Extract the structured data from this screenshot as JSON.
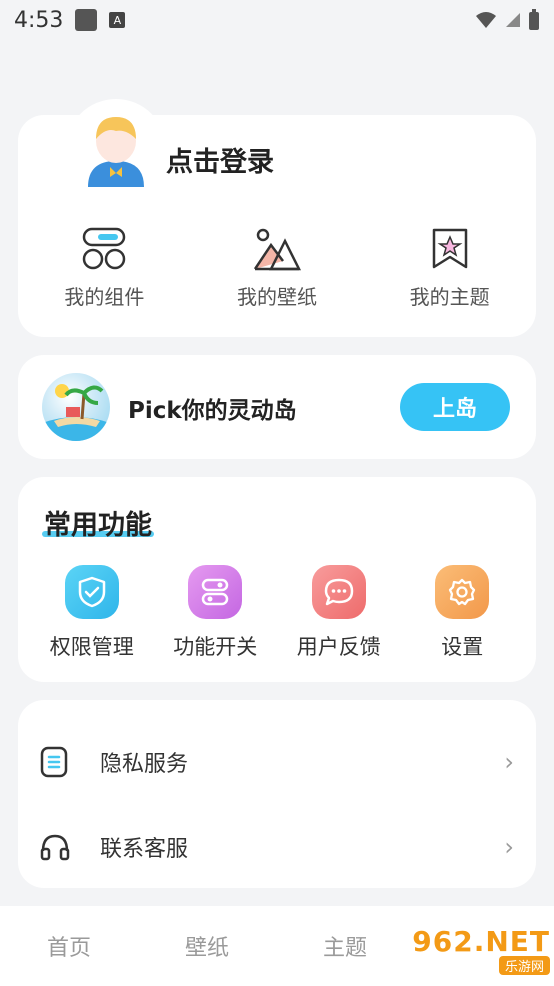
{
  "status_bar": {
    "time": "4:53",
    "notification_label": "A"
  },
  "login_card": {
    "title": "点击登录",
    "quick_items": [
      {
        "label": "我的组件",
        "icon": "widgets-icon"
      },
      {
        "label": "我的壁纸",
        "icon": "wallpaper-icon"
      },
      {
        "label": "我的主题",
        "icon": "theme-icon"
      }
    ]
  },
  "island_card": {
    "title": "Pick你的灵动岛",
    "button": "上岛"
  },
  "functions": {
    "title": "常用功能",
    "items": [
      {
        "label": "权限管理",
        "icon": "shield-icon",
        "color": "#3cc6ef"
      },
      {
        "label": "功能开关",
        "icon": "toggle-icon",
        "color": "#d77be8"
      },
      {
        "label": "用户反馈",
        "icon": "chat-icon",
        "color": "#f27c7c"
      },
      {
        "label": "设置",
        "icon": "gear-icon",
        "color": "#f5a85a"
      }
    ]
  },
  "list": [
    {
      "label": "隐私服务",
      "icon": "privacy-icon"
    },
    {
      "label": "联系客服",
      "icon": "headset-icon"
    }
  ],
  "bottom_nav": [
    "首页",
    "壁纸",
    "主题"
  ],
  "watermark": {
    "main": "962.NET",
    "sub": "乐游网"
  },
  "colors": {
    "accent": "#36c3f5",
    "background": "#f3f4f6"
  }
}
